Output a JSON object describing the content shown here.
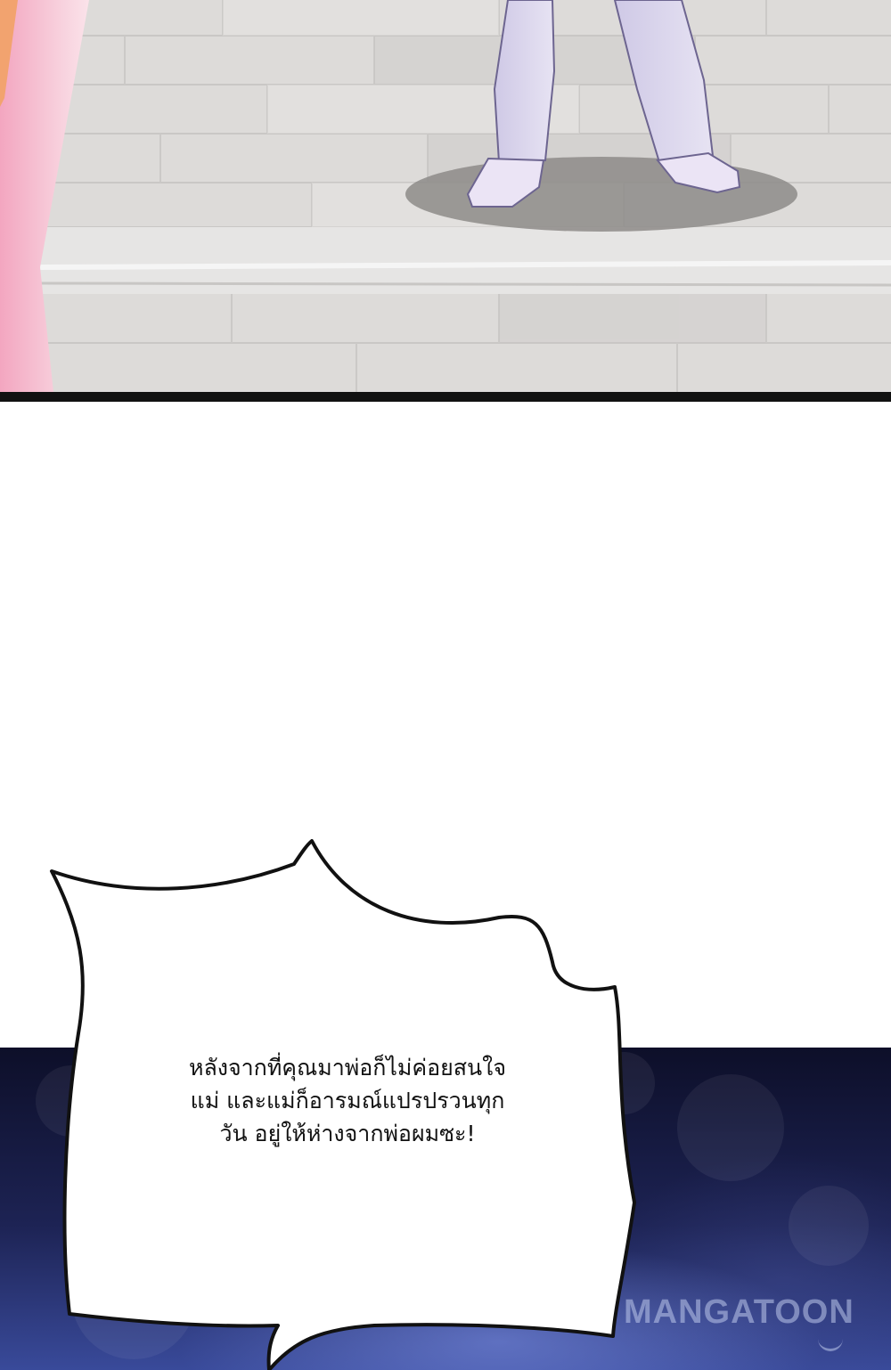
{
  "speech_bubble": {
    "lines": [
      "หลังจากที่คุณมาพ่อก็ไม่ค่อยสนใจ",
      "แม่ และแม่ก็อารมณ์แปรปรวนทุก",
      "วัน อยู่ให้ห่างจากพ่อผมซะ!"
    ]
  },
  "watermark": {
    "text": "MANGATOON"
  },
  "colors": {
    "floor": "#dcdad9",
    "divider": "#111111",
    "night_sky": "#1d2354"
  }
}
